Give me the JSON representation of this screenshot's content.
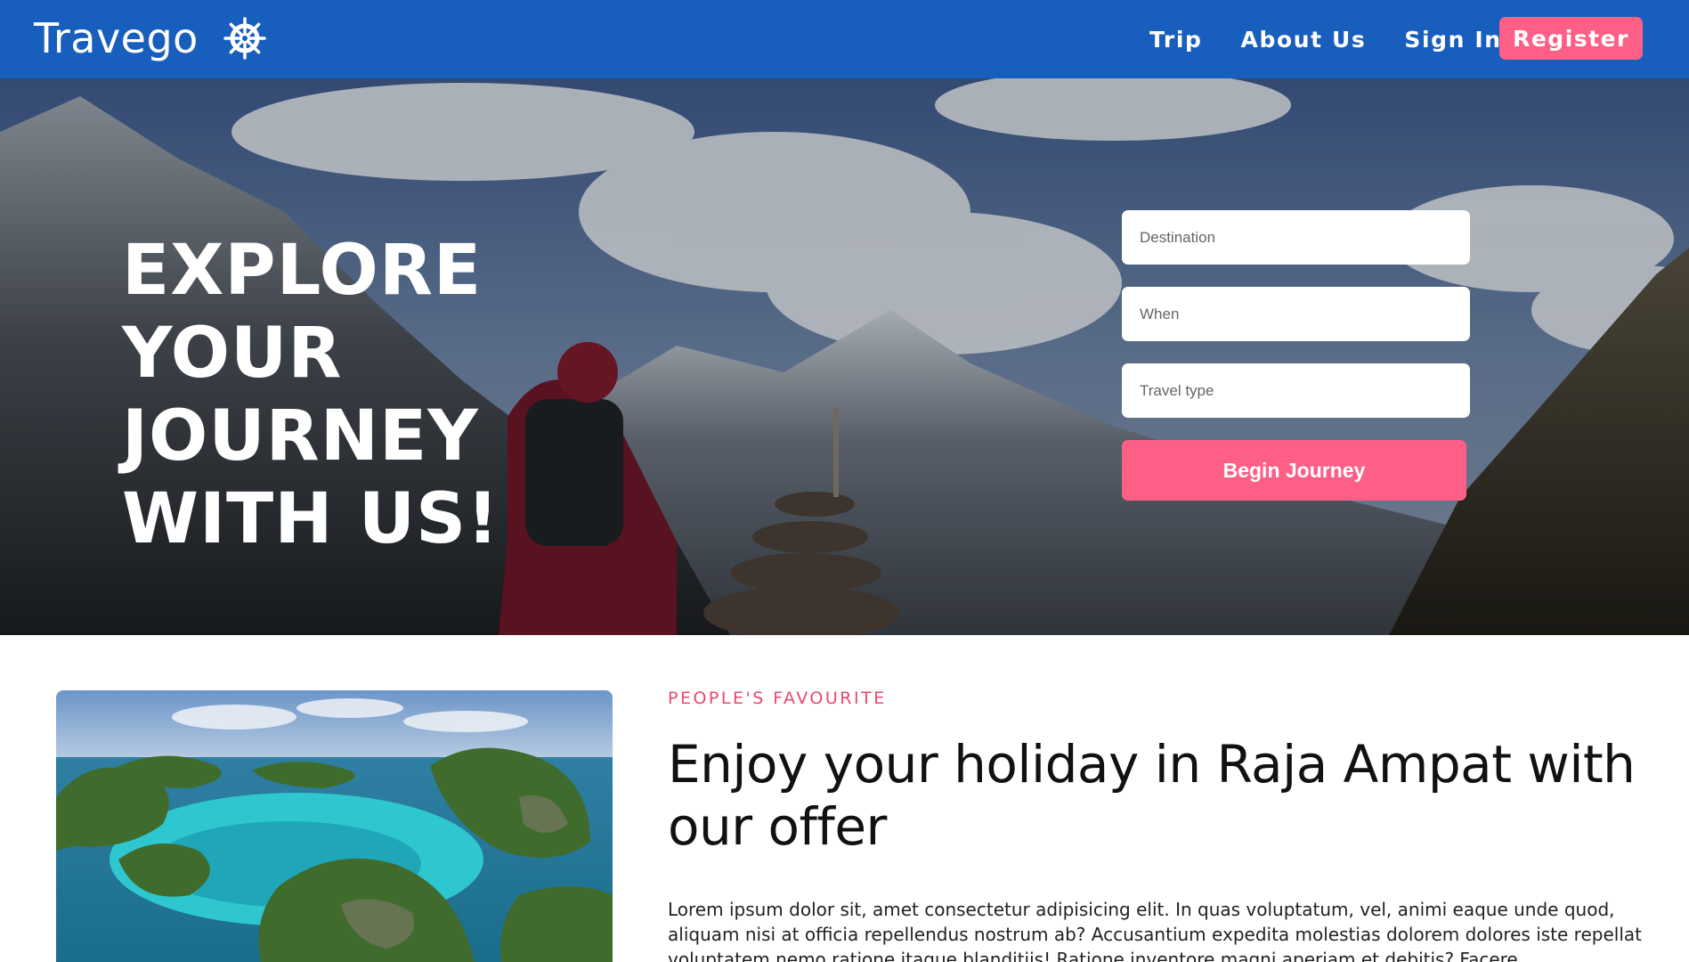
{
  "navbar": {
    "brand": "Travego",
    "brand_icon": "ship-wheel-icon",
    "links": [
      {
        "label": "Trip"
      },
      {
        "label": "About Us"
      },
      {
        "label": "Sign In"
      }
    ],
    "register_label": "Register"
  },
  "hero": {
    "title": "EXPLORE YOUR JOURNEY WITH US!",
    "form": {
      "destination_placeholder": "Destination",
      "when_placeholder": "When",
      "travel_type_placeholder": "Travel type",
      "submit_label": "Begin Journey"
    }
  },
  "feature": {
    "eyebrow": "PEOPLE'S FAVOURITE",
    "heading": "Enjoy your holiday in Raja Ampat with our offer",
    "body": "Lorem ipsum dolor sit, amet consectetur adipisicing elit. In quas voluptatum, vel, animi eaque unde quod, aliquam nisi at officia repellendus nostrum ab? Accusantium expedita molestias dolorem dolores iste repellat voluptatem nemo ratione itaque blanditiis! Ratione inventore magni aperiam et debitis? Facere"
  },
  "colors": {
    "navbar": "#185ebd",
    "accent": "#fd5f86",
    "eyebrow": "#e8496f"
  }
}
